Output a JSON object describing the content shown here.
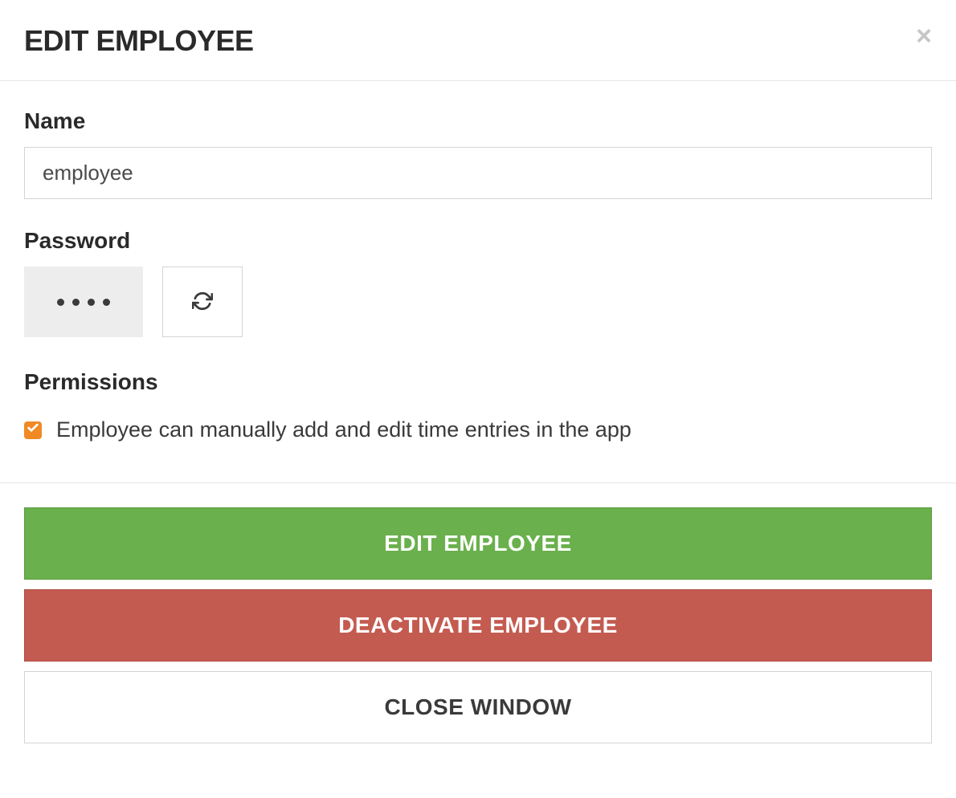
{
  "modal": {
    "title": "EDIT EMPLOYEE"
  },
  "fields": {
    "name_label": "Name",
    "name_value": "employee",
    "password_label": "Password",
    "permissions_label": "Permissions",
    "permission_checkbox_label": "Employee can manually add and edit time entries in the app",
    "permission_checked": true
  },
  "buttons": {
    "edit_employee": "EDIT EMPLOYEE",
    "deactivate_employee": "DEACTIVATE EMPLOYEE",
    "close_window": "CLOSE WINDOW"
  },
  "colors": {
    "primary_green": "#6ab04c",
    "danger_red": "#c45b50",
    "checkbox_orange": "#f08a24"
  }
}
